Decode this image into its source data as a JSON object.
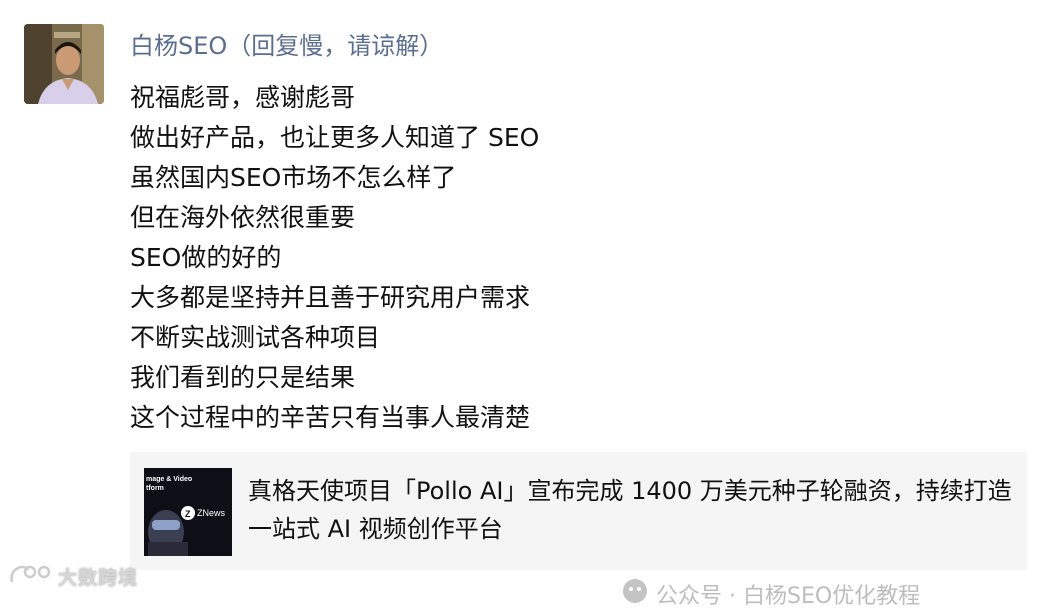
{
  "author": {
    "name": "白杨SEO（回复慢，请谅解）"
  },
  "message": {
    "lines": [
      "祝福彪哥，感谢彪哥",
      "做出好产品，也让更多人知道了 SEO",
      "虽然国内SEO市场不怎么样了",
      "但在海外依然很重要",
      "SEO做的好的",
      "大多都是坚持并且善于研究用户需求",
      "不断实战测试各种项目",
      "我们看到的只是结果",
      "这个过程中的辛苦只有当事人最清楚"
    ]
  },
  "link_card": {
    "title": "真格天使项目「Pollo AI」宣布完成 1400 万美元种子轮融资，持续打造一站式 AI 视频创作平台",
    "thumbnail_text_top": "mage & Video",
    "thumbnail_text_second": "tform",
    "thumbnail_brand": "ZNews"
  },
  "watermarks": {
    "left": "大数跨境",
    "right": "公众号 · 白杨SEO优化教程"
  },
  "colors": {
    "author_name": "#5a6e93",
    "message_text": "#111111",
    "card_background": "#f5f5f5",
    "watermark": "#bdbdbd"
  }
}
